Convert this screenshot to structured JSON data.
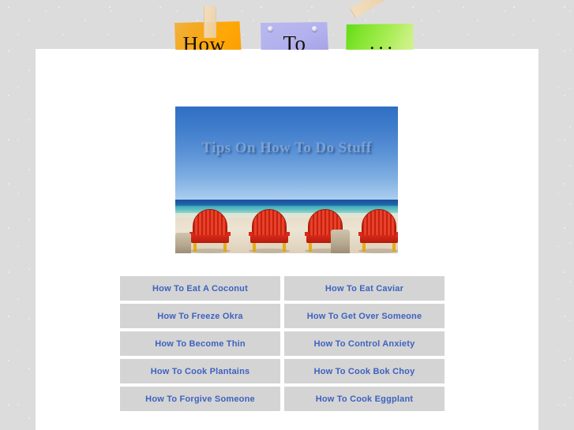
{
  "header": {
    "notes": [
      {
        "id": "how",
        "label": "How",
        "color": "#ffa806",
        "icon": "sticky-note-orange"
      },
      {
        "id": "to",
        "label": "To",
        "color": "#b4b2ee",
        "icon": "sticky-note-lavender"
      },
      {
        "id": "dots",
        "label": "...",
        "color": "#a3ec4e",
        "icon": "sticky-note-green"
      }
    ]
  },
  "banner": {
    "title": "Tips On How To Do Stuff",
    "alt": "beach-photo-four-red-adirondack-chairs",
    "colors": {
      "sky": "#5b92d6",
      "sea": "#1b5fa8",
      "turquoise": "#64c3c2",
      "sand": "#e8ddc8",
      "chair": "#d9291a",
      "chair_legs": "#f6c623",
      "title_text": "#7ba2d4"
    }
  },
  "links": {
    "cell_background": "#d4d4d4",
    "text_color": "#3d62bf",
    "items": [
      {
        "label": "How To Eat A Coconut"
      },
      {
        "label": "How To Eat Caviar"
      },
      {
        "label": "How To Freeze Okra"
      },
      {
        "label": "How To Get Over Someone"
      },
      {
        "label": "How To Become Thin"
      },
      {
        "label": "How To Control Anxiety"
      },
      {
        "label": "How To Cook Plantains"
      },
      {
        "label": "How To Cook Bok Choy"
      },
      {
        "label": "How To Forgive Someone"
      },
      {
        "label": "How To Cook Eggplant"
      }
    ]
  },
  "page": {
    "background": "#ffffff",
    "surround_background": "#dcdcdc"
  }
}
